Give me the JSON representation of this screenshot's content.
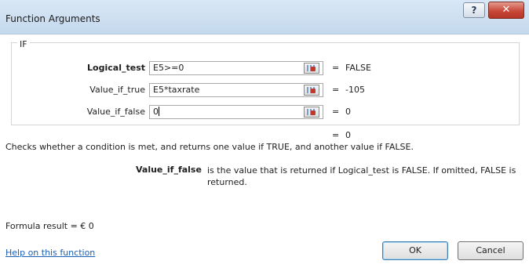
{
  "window": {
    "title": "Function Arguments",
    "help_glyph": "?",
    "close_glyph": "✕"
  },
  "function_name": "IF",
  "args": [
    {
      "label": "Logical_test",
      "value": "E5>=0",
      "result": "FALSE",
      "bold": true
    },
    {
      "label": "Value_if_true",
      "value": "E5*taxrate",
      "result": "-105",
      "bold": false
    },
    {
      "label": "Value_if_false",
      "value": "0",
      "result": "0",
      "bold": false
    }
  ],
  "overall": {
    "equals": "=",
    "result": "0"
  },
  "description": "Checks whether a condition is met, and returns one value if TRUE, and another value if FALSE.",
  "param": {
    "name": "Value_if_false",
    "text": "is the value that is returned if Logical_test is FALSE. If omitted, FALSE is returned."
  },
  "formula_result": "Formula result =  € 0",
  "help_link": "Help on this function",
  "buttons": {
    "ok": "OK",
    "cancel": "Cancel"
  },
  "icons": {
    "range_select": "range-select-icon",
    "help": "help-icon",
    "close": "close-icon"
  },
  "colors": {
    "title_bar": "#c4d9ee",
    "close_button": "#c8483a",
    "link": "#1a5fb4",
    "default_button_border": "#3c7fb1"
  }
}
